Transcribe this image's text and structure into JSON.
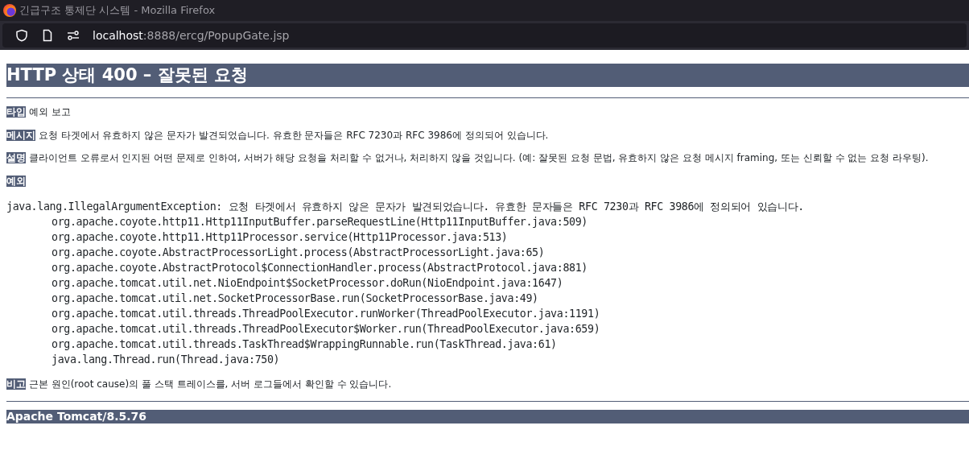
{
  "window": {
    "title": "긴급구조 통제단 시스템 - Mozilla Firefox"
  },
  "address_bar": {
    "host": "localhost",
    "path": ":8888/ercg/PopupGate.jsp"
  },
  "heading": "HTTP 상태 400 – 잘못된 요청",
  "fields": [
    {
      "label": "타입",
      "text": "예외 보고"
    },
    {
      "label": "메시지",
      "text": "요청 타겟에서 유효하지 않은 문자가 발견되었습니다. 유효한 문자들은 RFC 7230과 RFC 3986에 정의되어 있습니다."
    },
    {
      "label": "설명",
      "text": "클라이언트 오류로서 인지된 어떤 문제로 인하여, 서버가 해당 요청을 처리할 수 없거나, 처리하지 않을 것입니다. (예: 잘못된 요청 문법, 유효하지 않은 요청 메시지 framing, 또는 신뢰할 수 없는 요청 라우팅)."
    },
    {
      "label": "예외"
    }
  ],
  "exception": "java.lang.IllegalArgumentException: 요청 타겟에서 유효하지 않은 문자가 발견되었습니다. 유효한 문자들은 RFC 7230과 RFC 3986에 정의되어 있습니다.",
  "frames": [
    "org.apache.coyote.http11.Http11InputBuffer.parseRequestLine(Http11InputBuffer.java:509)",
    "org.apache.coyote.http11.Http11Processor.service(Http11Processor.java:513)",
    "org.apache.coyote.AbstractProcessorLight.process(AbstractProcessorLight.java:65)",
    "org.apache.coyote.AbstractProtocol$ConnectionHandler.process(AbstractProtocol.java:881)",
    "org.apache.tomcat.util.net.NioEndpoint$SocketProcessor.doRun(NioEndpoint.java:1647)",
    "org.apache.tomcat.util.net.SocketProcessorBase.run(SocketProcessorBase.java:49)",
    "org.apache.tomcat.util.threads.ThreadPoolExecutor.runWorker(ThreadPoolExecutor.java:1191)",
    "org.apache.tomcat.util.threads.ThreadPoolExecutor$Worker.run(ThreadPoolExecutor.java:659)",
    "org.apache.tomcat.util.threads.TaskThread$WrappingRunnable.run(TaskThread.java:61)",
    "java.lang.Thread.run(Thread.java:750)"
  ],
  "note": {
    "label": "비고",
    "text": "근본 원인(root cause)의 풀 스택 트레이스를, 서버 로그들에서 확인할 수 있습니다."
  },
  "footer": "Apache Tomcat/8.5.76"
}
